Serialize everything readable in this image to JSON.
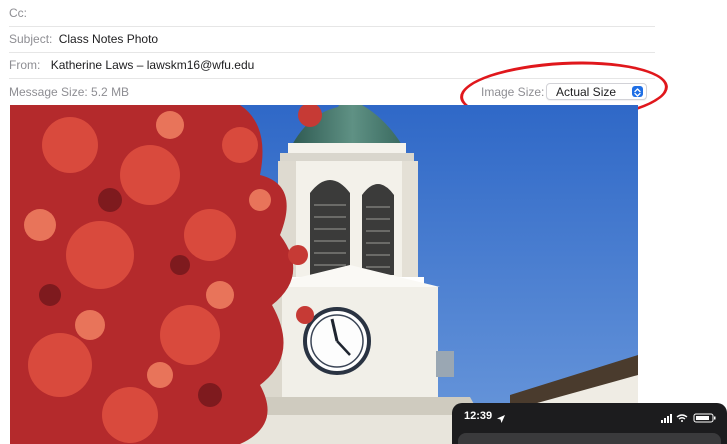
{
  "mail_header": {
    "cc": {
      "label": "Cc:",
      "value": ""
    },
    "subject": {
      "label": "Subject:",
      "value": "Class Notes Photo"
    },
    "from": {
      "label": "From:",
      "value": "Katherine Laws – lawskm16@wfu.edu"
    },
    "message_size": {
      "label": "Message Size:",
      "value": "5.2 MB"
    },
    "image_size": {
      "label": "Image Size:",
      "selected": "Actual Size"
    }
  },
  "attachment": {
    "icon": "photo-attachment-clock-tower-autumn"
  },
  "annotation": {
    "color": "#e0171c"
  },
  "phone_overlay": {
    "time": "12:39",
    "icons": [
      "location-arrow-icon",
      "signal-bars-icon",
      "wifi-icon",
      "battery-icon"
    ]
  },
  "colors": {
    "accent": "#1f6fe5",
    "label_gray": "#8e8e93",
    "annotation_red": "#e0171c"
  }
}
